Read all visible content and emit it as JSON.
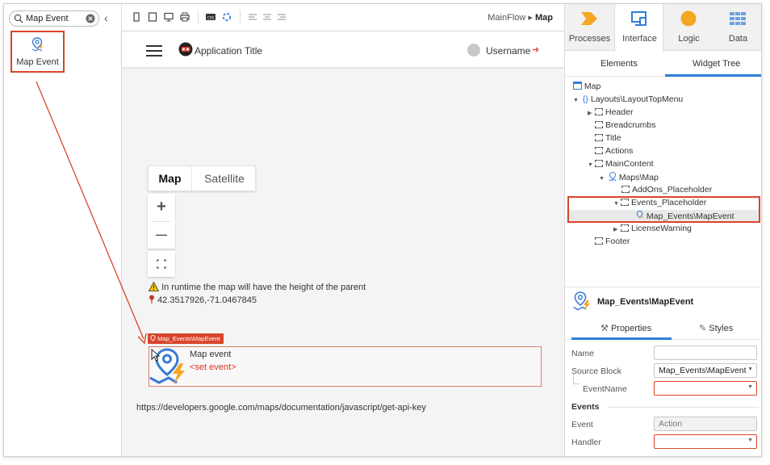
{
  "left_panel": {
    "search_value": "Map Event",
    "widget_label": "Map Event"
  },
  "canvas": {
    "breadcrumb_flow": "MainFlow",
    "breadcrumb_sep": "▸",
    "breadcrumb_screen": "Map",
    "app_title": "Application Title",
    "username": "Username",
    "map_type_map": "Map",
    "map_type_satellite": "Satellite",
    "zoom_in": "+",
    "zoom_out": "—",
    "warning_text": "In runtime the map will have the height of the parent",
    "coordinates": "42.3517926,-71.0467845",
    "event_tag": "Map_Events\\MapEvent",
    "event_name": "Map event",
    "event_placeholder": "<set event>",
    "api_url": "https://developers.google.com/maps/documentation/javascript/get-api-key"
  },
  "right_panel": {
    "tabs": [
      {
        "label": "Processes",
        "icon": "processes-icon",
        "color": "#f5a623"
      },
      {
        "label": "Interface",
        "icon": "interface-icon",
        "color": "#2f7ed8"
      },
      {
        "label": "Logic",
        "icon": "logic-icon",
        "color": "#f5a623"
      },
      {
        "label": "Data",
        "icon": "data-icon",
        "color": "#6aa2e0"
      }
    ],
    "subtabs": {
      "elements": "Elements",
      "widget_tree": "Widget Tree"
    },
    "tree": {
      "map": "Map",
      "layout": "Layouts\\LayoutTopMenu",
      "header": "Header",
      "breadcrumbs": "Breadcrumbs",
      "title": "Title",
      "actions": "Actions",
      "main_content": "MainContent",
      "maps_map": "Maps\\Map",
      "addons": "AddOns_Placeholder",
      "events_placeholder": "Events_Placeholder",
      "map_events": "Map_Events\\MapEvent",
      "license": "LicenseWarning",
      "footer": "Footer"
    },
    "properties": {
      "title": "Map_Events\\MapEvent",
      "tab_properties": "Properties",
      "tab_styles": "Styles",
      "name_label": "Name",
      "name_value": "",
      "source_label": "Source Block",
      "source_value": "Map_Events\\MapEvent",
      "eventname_label": "EventName",
      "eventname_value": "",
      "events_section": "Events",
      "event_label": "Event",
      "event_value": "Action",
      "handler_label": "Handler",
      "handler_value": ""
    }
  },
  "colors": {
    "highlight": "#d9452b",
    "accent": "#2f7ed8",
    "orange": "#f5a623"
  }
}
